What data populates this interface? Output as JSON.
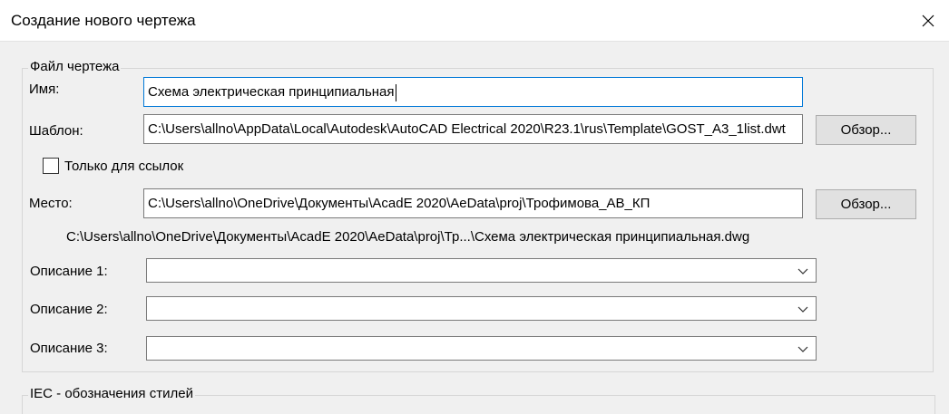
{
  "window": {
    "title": "Создание нового чертежа"
  },
  "group": {
    "label": "Файл чертежа"
  },
  "name": {
    "label": "Имя:",
    "value": "Схема электрическая принципиальная"
  },
  "template": {
    "label": "Шаблон:",
    "value": "C:\\Users\\allno\\AppData\\Local\\Autodesk\\AutoCAD Electrical 2020\\R23.1\\rus\\Template\\GOST_A3_1list.dwt",
    "browse_label": "Обзор..."
  },
  "reference_only": {
    "label": "Только для ссылок",
    "checked": false
  },
  "location": {
    "label": "Место:",
    "value": "C:\\Users\\allno\\OneDrive\\Документы\\AcadE 2020\\AeData\\proj\\Трофимова_АВ_КП",
    "browse_label": "Обзор..."
  },
  "full_path": "C:\\Users\\allno\\OneDrive\\Документы\\AcadE 2020\\AeData\\proj\\Тр...\\Схема электрическая принципиальная.dwg",
  "descriptions": [
    {
      "label": "Описание 1:",
      "value": ""
    },
    {
      "label": "Описание 2:",
      "value": ""
    },
    {
      "label": "Описание 3:",
      "value": ""
    }
  ],
  "iec_group": {
    "label": "IEC - обозначения стилей"
  },
  "colors": {
    "focus_border": "#0078d7",
    "button_bg": "#e1e1e1",
    "dialog_bg": "#f0f0f0"
  }
}
